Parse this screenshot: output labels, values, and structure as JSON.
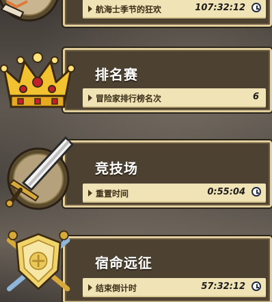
{
  "events": [
    {
      "title": "",
      "subtitle": "航海士季节的狂欢",
      "value": "107:32:12",
      "has_clock": true,
      "emblem": "ship-icon"
    },
    {
      "title": "排名赛",
      "subtitle": "冒险家排行榜名次",
      "value": "6",
      "has_clock": false,
      "emblem": "crown-icon"
    },
    {
      "title": "竞技场",
      "subtitle": "重置时间",
      "value": "0:55:04",
      "has_clock": true,
      "emblem": "sword-icon"
    },
    {
      "title": "宿命远征",
      "subtitle": "结束倒计时",
      "value": "57:32:12",
      "has_clock": true,
      "emblem": "shield-icon"
    }
  ],
  "colors": {
    "panel": "#4d4231",
    "border": "#e3cf9e",
    "subbar": "#f0e3b6"
  }
}
